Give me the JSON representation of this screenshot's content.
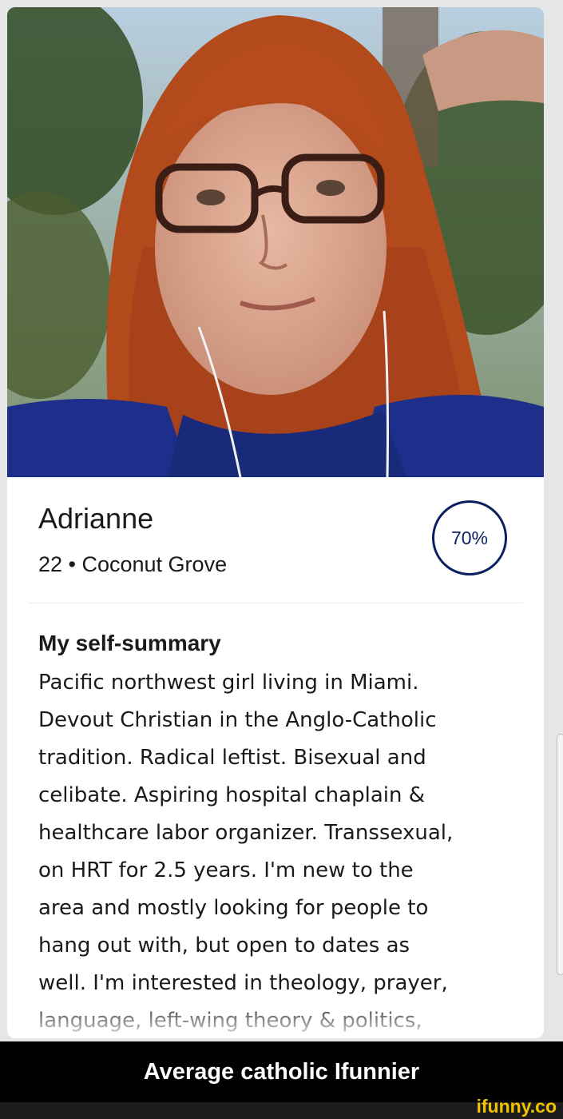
{
  "profile": {
    "name": "Adrianne",
    "age_location": "22 • Coconut Grove",
    "match_percent": "70%",
    "summary_title": "My self-summary",
    "summary_lines": [
      "Pacific northwest girl living in Miami.",
      "Devout Christian in the Anglo-Catholic",
      "tradition. Radical leftist. Bisexual and",
      "celibate. Aspiring hospital chaplain &",
      "healthcare labor organizer. Transsexual,",
      "on HRT for 2.5 years. I'm new to the",
      "area and mostly looking for people to",
      "hang out with, but open to dates as",
      "well. I'm interested in theology, prayer,",
      "language, left-wing theory & politics,"
    ],
    "photo_alt": "profile-photo"
  },
  "caption": {
    "text": "Average catholic Ifunnier"
  },
  "watermark": {
    "text": "ifunny.co"
  },
  "colors": {
    "match_ring": "#0b1f61",
    "caption_bg": "#000000",
    "watermark": "#f2c200"
  }
}
